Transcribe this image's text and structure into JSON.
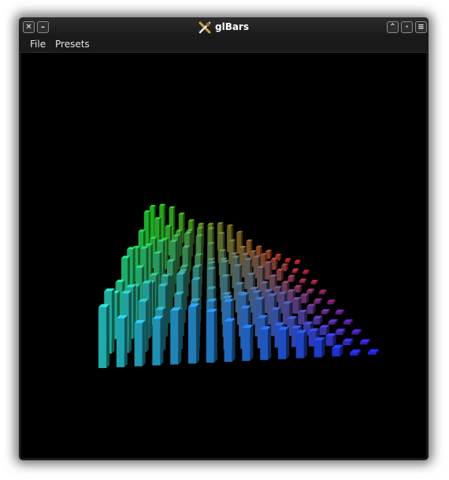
{
  "window": {
    "title": "glBars",
    "icon": "glbars-app-icon",
    "buttons": {
      "close": "✕",
      "minimize": "–",
      "shade": "⌃",
      "sticky": "·",
      "menu": "≡"
    }
  },
  "menubar": {
    "items": [
      {
        "label": "File"
      },
      {
        "label": "Presets"
      }
    ]
  },
  "visualization": {
    "type": "3d-bar-spectrum",
    "background": "#000000",
    "gradient_colors": {
      "back_left": "#22cc22",
      "back_right": "#cc2222",
      "front_left": "#26c9c9",
      "front_right": "#2424f0"
    },
    "rows": 10,
    "columns": 16,
    "levels_front_row": [
      1.0,
      0.95,
      0.92,
      0.9,
      0.88,
      0.85,
      0.8,
      0.75,
      0.7,
      0.62,
      0.5,
      0.38,
      0.26,
      0.15,
      0.06,
      0.04
    ]
  }
}
